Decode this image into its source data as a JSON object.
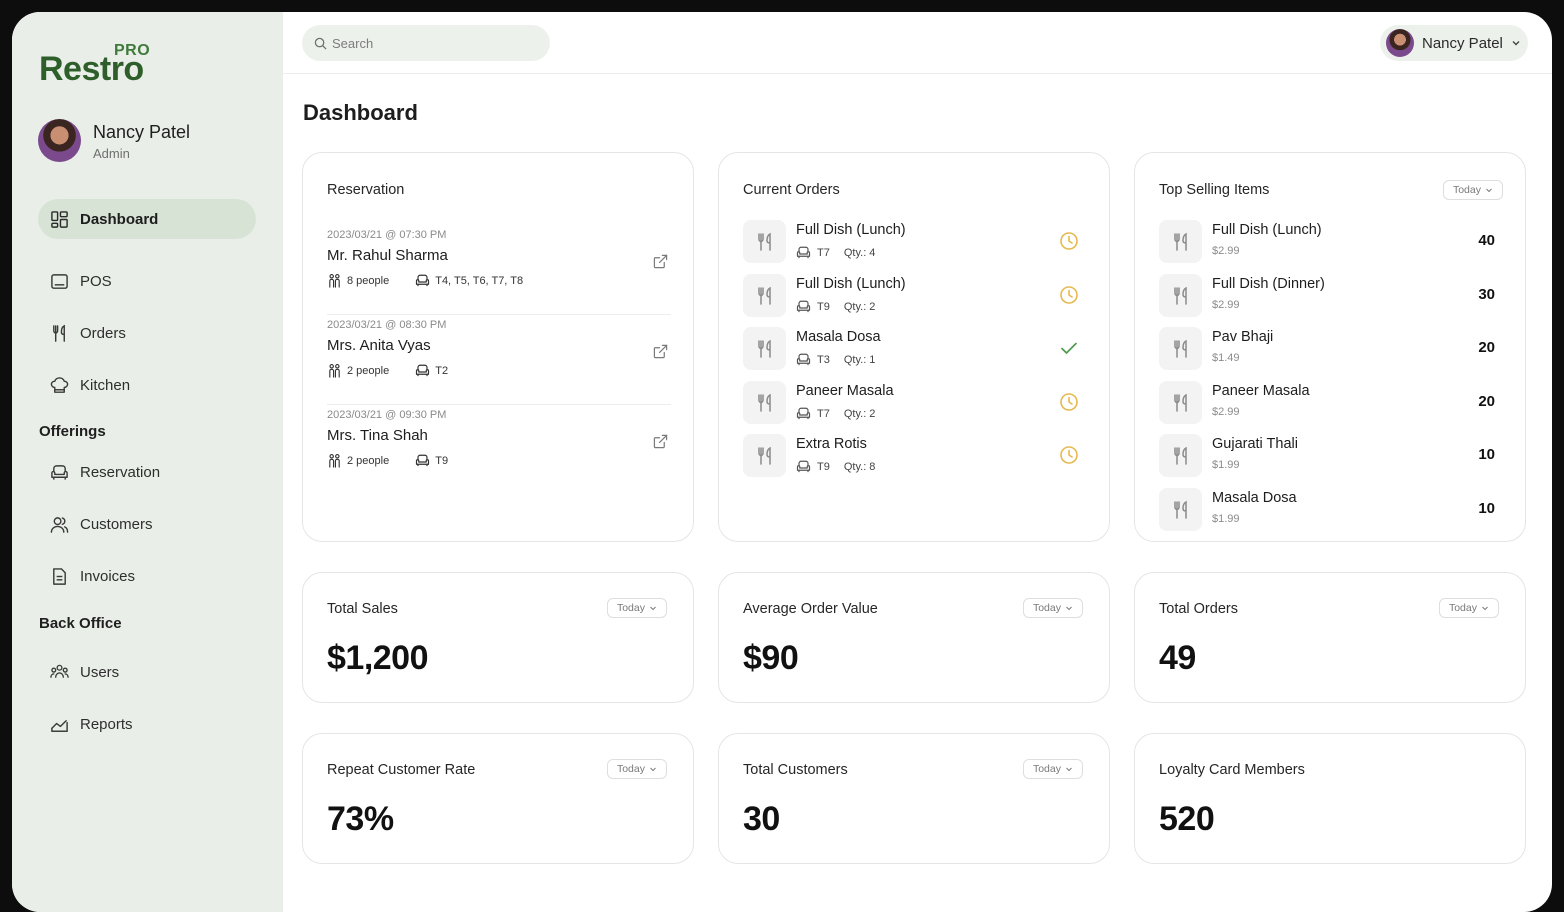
{
  "app": {
    "logo_name": "Restro",
    "logo_badge": "PRO"
  },
  "profile": {
    "name": "Nancy Patel",
    "role": "Admin"
  },
  "nav": {
    "dashboard": "Dashboard",
    "pos": "POS",
    "orders": "Orders",
    "kitchen": "Kitchen",
    "offerings_title": "Offerings",
    "reservation": "Reservation",
    "customers": "Customers",
    "invoices": "Invoices",
    "backoffice_title": "Back Office",
    "users": "Users",
    "reports": "Reports"
  },
  "search": {
    "placeholder": "Search",
    "value": ""
  },
  "user_menu": {
    "name": "Nancy Patel"
  },
  "page": {
    "title": "Dashboard"
  },
  "reservation": {
    "title": "Reservation",
    "items": [
      {
        "date": "2023/03/21 @ 07:30 PM",
        "name": "Mr. Rahul Sharma",
        "people": "8 people",
        "tables": "T4, T5, T6, T7, T8"
      },
      {
        "date": "2023/03/21 @ 08:30 PM",
        "name": "Mrs. Anita Vyas",
        "people": "2 people",
        "tables": "T2"
      },
      {
        "date": "2023/03/21 @ 09:30 PM",
        "name": "Mrs. Tina Shah",
        "people": "2 people",
        "tables": "T9"
      }
    ]
  },
  "current_orders": {
    "title": "Current Orders",
    "items": [
      {
        "name": "Full Dish (Lunch)",
        "table": "T7",
        "qty": "Qty.: 4",
        "status": "pending"
      },
      {
        "name": "Full Dish (Lunch)",
        "table": "T9",
        "qty": "Qty.: 2",
        "status": "pending"
      },
      {
        "name": "Masala Dosa",
        "table": "T3",
        "qty": "Qty.: 1",
        "status": "done"
      },
      {
        "name": "Paneer Masala",
        "table": "T7",
        "qty": "Qty.: 2",
        "status": "pending"
      },
      {
        "name": "Extra Rotis",
        "table": "T9",
        "qty": "Qty.: 8",
        "status": "pending"
      }
    ]
  },
  "top_selling": {
    "title": "Top Selling Items",
    "filter": "Today",
    "items": [
      {
        "name": "Full Dish (Lunch)",
        "price": "$2.99",
        "count": "40"
      },
      {
        "name": "Full Dish (Dinner)",
        "price": "$2.99",
        "count": "30"
      },
      {
        "name": "Pav Bhaji",
        "price": "$1.49",
        "count": "20"
      },
      {
        "name": "Paneer Masala",
        "price": "$2.99",
        "count": "20"
      },
      {
        "name": "Gujarati Thali",
        "price": "$1.99",
        "count": "10"
      },
      {
        "name": "Masala Dosa",
        "price": "$1.99",
        "count": "10"
      }
    ]
  },
  "stats": {
    "total_sales": {
      "label": "Total Sales",
      "value": "$1,200",
      "filter": "Today"
    },
    "avg_order": {
      "label": "Average Order Value",
      "value": "$90",
      "filter": "Today"
    },
    "total_orders": {
      "label": "Total Orders",
      "value": "49",
      "filter": "Today"
    },
    "repeat_rate": {
      "label": "Repeat Customer Rate",
      "value": "73%",
      "filter": "Today"
    },
    "total_customers": {
      "label": "Total Customers",
      "value": "30",
      "filter": "Today"
    },
    "loyalty": {
      "label": "Loyalty Card Members",
      "value": "520"
    }
  },
  "colors": {
    "sidebar_bg": "#e9efe8",
    "active_nav": "#d7e4d5",
    "brand_green": "#2e5f2b",
    "pending": "#e5b94f",
    "done": "#4f9a4c"
  },
  "icons": {
    "pending": "clock-icon",
    "done": "check-icon",
    "dish": "fork-knife-icon",
    "table": "armchair-icon",
    "people": "people-icon",
    "link": "external-link-icon"
  }
}
